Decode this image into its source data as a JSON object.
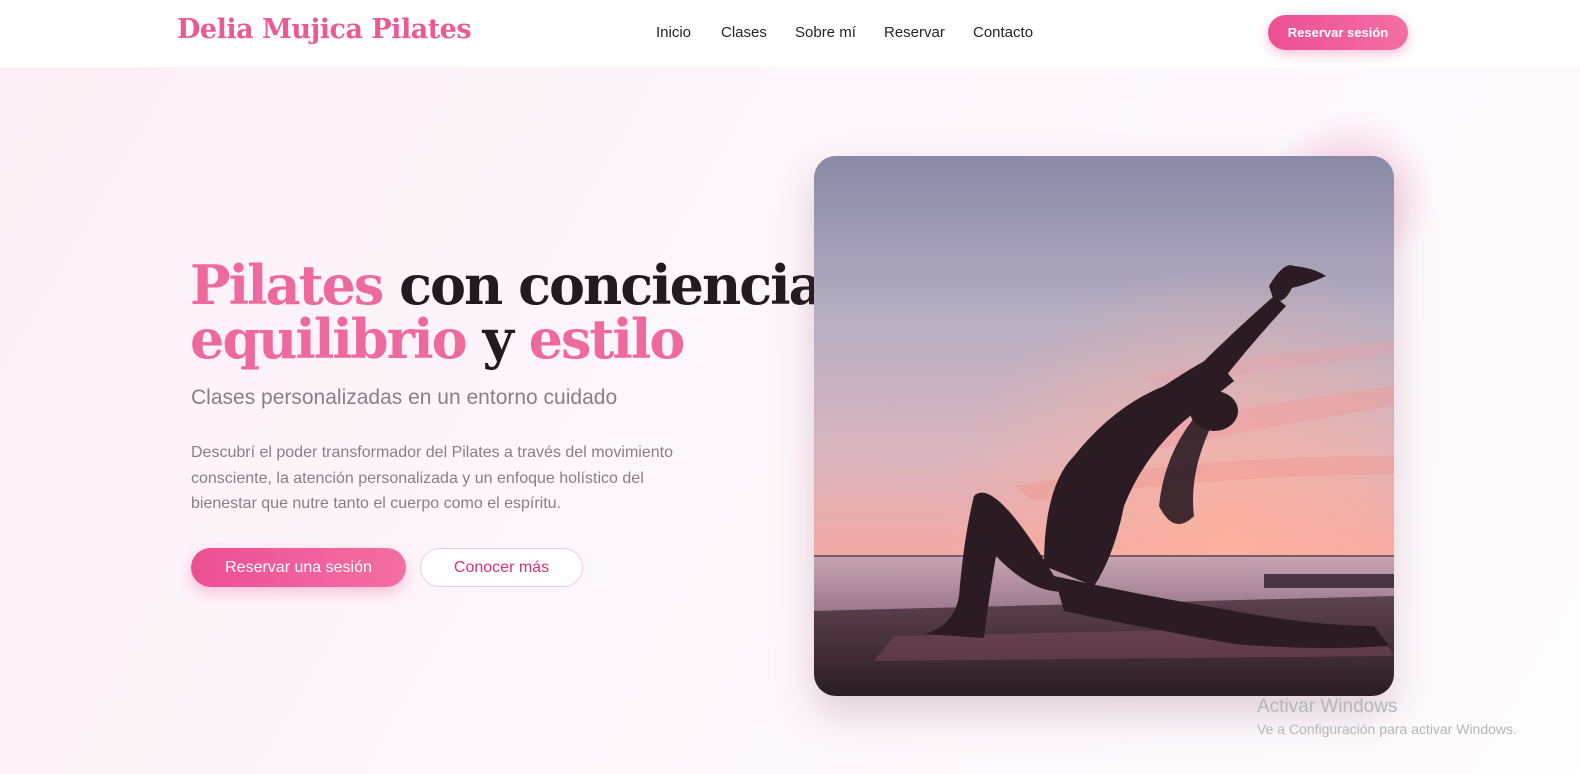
{
  "header": {
    "brand": "Delia Mujica Pilates",
    "nav": [
      "Inicio",
      "Clases",
      "Sobre mí",
      "Reservar",
      "Contacto"
    ],
    "cta_label": "Reservar sesión"
  },
  "hero": {
    "title_parts": [
      "Pilates",
      " con conciencia,",
      "equilibrio",
      " y ",
      "estilo"
    ],
    "subtitle": "Clases personalizadas en un entorno cuidado",
    "description": "Descubrí el poder transformador del Pilates a través del movimiento consciente, la atención personalizada y un enfoque holístico del bienestar que nutre tanto el cuerpo como el espíritu.",
    "primary_button": "Reservar una sesión",
    "secondary_button": "Conocer más",
    "image_alt": "Silueta de mujer haciendo una postura de estiramiento frente al mar al atardecer"
  },
  "watermark": {
    "title": "Activar Windows",
    "subtitle": "Ve a Configuración para activar Windows."
  },
  "colors": {
    "accent": "#ec4f93",
    "accent_light": "#f46fa3",
    "title_dark": "#221a1e",
    "text_muted": "#8a7e84"
  }
}
